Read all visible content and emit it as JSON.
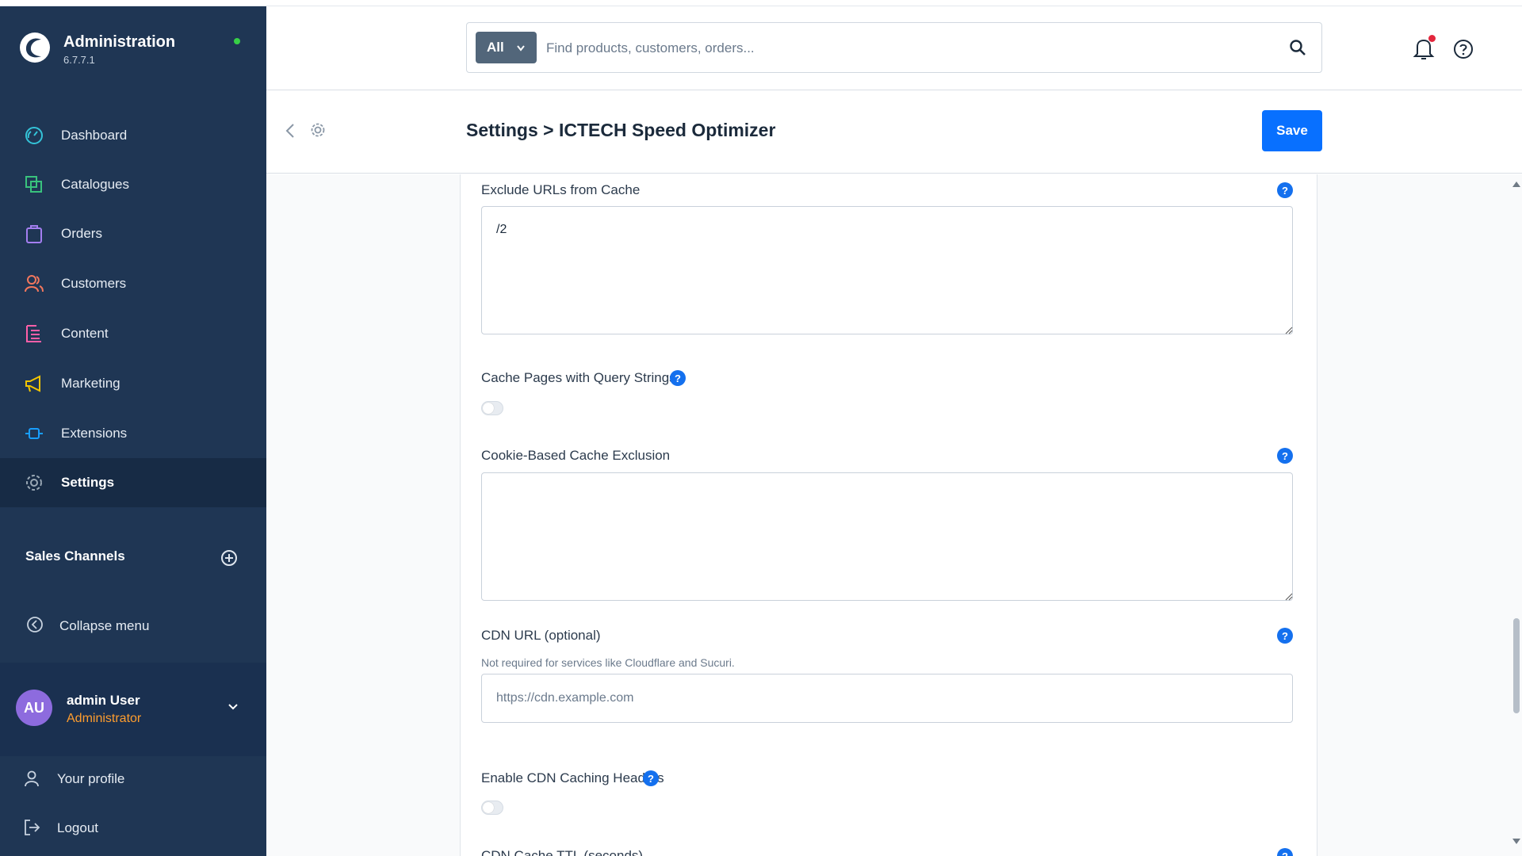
{
  "app": {
    "name": "Administration",
    "version": "6.7.7.1"
  },
  "sidebar": {
    "items": [
      {
        "label": "Dashboard",
        "icon": "dashboard-icon",
        "color": "#34c3d8"
      },
      {
        "label": "Catalogues",
        "icon": "catalogues-icon",
        "color": "#39c27d"
      },
      {
        "label": "Orders",
        "icon": "orders-icon",
        "color": "#a37ef0"
      },
      {
        "label": "Customers",
        "icon": "customers-icon",
        "color": "#f3775d"
      },
      {
        "label": "Content",
        "icon": "content-icon",
        "color": "#ff5fa8"
      },
      {
        "label": "Marketing",
        "icon": "marketing-icon",
        "color": "#f2c500"
      },
      {
        "label": "Extensions",
        "icon": "extensions-icon",
        "color": "#189eff"
      },
      {
        "label": "Settings",
        "icon": "settings-icon",
        "color": "#9aa8b5",
        "active": true
      }
    ],
    "sales_channels": "Sales Channels",
    "collapse_label": "Collapse menu",
    "user": {
      "initials": "AU",
      "name": "admin User",
      "role": "Administrator"
    },
    "profile_label": "Your profile",
    "logout_label": "Logout"
  },
  "topbar": {
    "search_scope": "All",
    "search_placeholder": "Find products, customers, orders..."
  },
  "header": {
    "title": "Settings > ICTECH Speed Optimizer",
    "save_label": "Save"
  },
  "form": {
    "exclude_urls": {
      "label": "Exclude URLs from Cache",
      "value": "/2"
    },
    "cache_query": {
      "label": "Cache Pages with Query Strings",
      "enabled": false
    },
    "cookie_exclusion": {
      "label": "Cookie-Based Cache Exclusion",
      "value": ""
    },
    "cdn_url": {
      "label": "CDN URL (optional)",
      "hint": "Not required for services like Cloudflare and Sucuri.",
      "placeholder": "https://cdn.example.com"
    },
    "cdn_headers": {
      "label": "Enable CDN Caching Headers",
      "enabled": false
    },
    "cdn_ttl": {
      "label": "CDN Cache TTL (seconds)"
    }
  },
  "colors": {
    "sidebar_bg": "#1f3654",
    "primary": "#0870ff",
    "help_badge": "#1470ee",
    "role": "#ff9d2e"
  }
}
